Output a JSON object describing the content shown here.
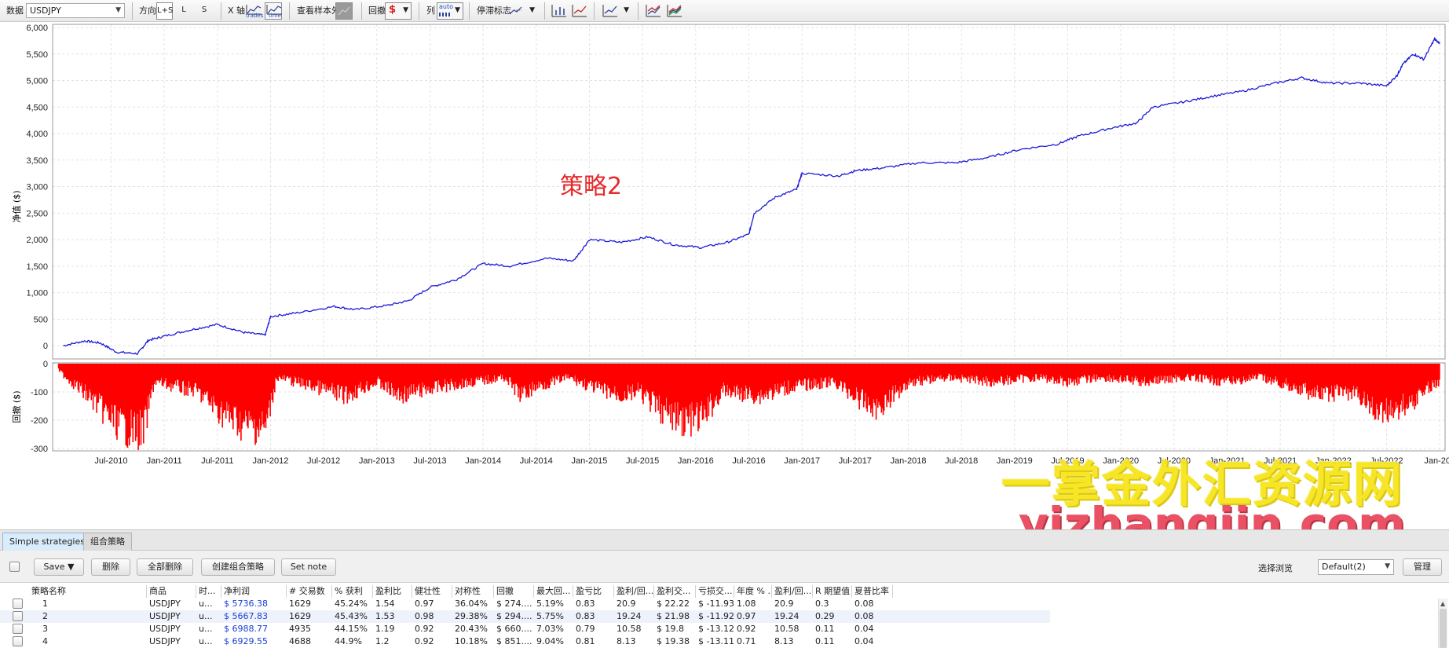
{
  "toolbar": {
    "data_label": "数据",
    "symbol_value": "USDJPY",
    "direction_label": "方向",
    "dir_both": "L+S",
    "dir_long": "L",
    "dir_short": "S",
    "xaxis_label": "X 轴",
    "xaxis_trades": "trades",
    "xaxis_time": "time",
    "oos_label": "查看样本外",
    "drawdown_label": "回撤",
    "drawdown_unit": "$",
    "columns_label": "列",
    "columns_auto": "auto",
    "stop_label": "停滞标志"
  },
  "chart": {
    "annotation": "策略2",
    "equity_ylabel": "净值 ($)",
    "drawdown_ylabel": "回撤 ($)",
    "line_color": "#1a1ad8",
    "bar_color": "#ff0000"
  },
  "watermark": {
    "line1": "一掌金外汇资源网",
    "line2": "yizhangjin.com"
  },
  "chart_data": [
    {
      "type": "line",
      "title": "",
      "xlabel": "",
      "ylabel": "净值 ($)",
      "ylim": [
        -200,
        6000
      ],
      "yticks": [
        "6,000",
        "5,500",
        "5,000",
        "4,500",
        "4,000",
        "3,500",
        "3,000",
        "2,500",
        "2,000",
        "1,500",
        "1,000",
        "500",
        "0"
      ],
      "x_ticks": [
        "Jul-2010",
        "Jan-2011",
        "Jul-2011",
        "Jan-2012",
        "Jul-2012",
        "Jan-2013",
        "Jul-2013",
        "Jan-2014",
        "Jul-2014",
        "Jan-2015",
        "Jul-2015",
        "Jan-2016",
        "Jul-2016",
        "Jan-2017",
        "Jul-2017",
        "Jan-2018",
        "Jul-2018",
        "Jan-2019",
        "Jul-2019",
        "Jan-2020",
        "Jul-2020",
        "Jan-2021",
        "Jul-2021",
        "Jan-2022",
        "Jul-2022",
        "Jan-202"
      ],
      "grid": true,
      "series": [
        {
          "x": [
            2010.05,
            2010.25,
            2010.4,
            2010.55,
            2010.75,
            2010.85,
            2011.0,
            2011.25,
            2011.5,
            2011.75,
            2011.95,
            2012.0,
            2012.25,
            2012.6,
            2012.8,
            2013.1,
            2013.3,
            2013.5,
            2013.75,
            2014.0,
            2014.25,
            2014.6,
            2014.85,
            2015.0,
            2015.3,
            2015.55,
            2015.8,
            2016.05,
            2016.3,
            2016.5,
            2016.55,
            2016.75,
            2016.95,
            2017.0,
            2017.35,
            2017.5,
            2017.75,
            2018.1,
            2018.45,
            2018.75,
            2019.05,
            2019.4,
            2019.6,
            2019.9,
            2020.15,
            2020.3,
            2020.6,
            2020.85,
            2021.15,
            2021.45,
            2021.7,
            2021.95,
            2022.25,
            2022.5,
            2022.6,
            2022.65,
            2022.75,
            2022.85,
            2022.95,
            2023.0
          ],
          "y": [
            0,
            90,
            50,
            -120,
            -150,
            100,
            180,
            300,
            400,
            250,
            200,
            550,
            620,
            740,
            680,
            760,
            850,
            1100,
            1250,
            1550,
            1500,
            1650,
            1600,
            2000,
            1950,
            2050,
            1900,
            1850,
            1950,
            2100,
            2500,
            2800,
            2950,
            3250,
            3200,
            3300,
            3350,
            3450,
            3450,
            3550,
            3700,
            3800,
            3950,
            4100,
            4200,
            4500,
            4600,
            4700,
            4800,
            4950,
            5050,
            4950,
            4950,
            4900,
            5100,
            5300,
            5500,
            5400,
            5780,
            5700
          ]
        }
      ]
    },
    {
      "type": "bar",
      "title": "",
      "xlabel": "",
      "ylabel": "回撤 ($)",
      "ylim": [
        -300,
        0
      ],
      "yticks": [
        "0",
        "-100",
        "-200",
        "-300"
      ],
      "grid": true,
      "series": [
        {
          "x": [
            2010.0,
            2010.3,
            2010.45,
            2010.6,
            2010.8,
            2010.9,
            2011.3,
            2011.55,
            2011.75,
            2011.95,
            2012.05,
            2012.4,
            2012.7,
            2013.0,
            2013.2,
            2013.6,
            2013.9,
            2014.2,
            2014.35,
            2014.5,
            2014.8,
            2015.0,
            2015.3,
            2015.45,
            2015.6,
            2015.75,
            2015.9,
            2016.05,
            2016.25,
            2016.6,
            2016.9,
            2017.3,
            2017.55,
            2017.7,
            2018.0,
            2018.4,
            2018.8,
            2019.2,
            2019.5,
            2019.8,
            2020.2,
            2020.6,
            2021.0,
            2021.3,
            2021.6,
            2021.9,
            2022.1,
            2022.3,
            2022.4,
            2022.55,
            2022.7,
            2022.9,
            2023.0
          ],
          "values": [
            -30,
            -150,
            -220,
            -280,
            -300,
            -80,
            -120,
            -220,
            -270,
            -280,
            -60,
            -100,
            -140,
            -80,
            -140,
            -100,
            -80,
            -60,
            -140,
            -100,
            -60,
            -100,
            -140,
            -120,
            -180,
            -230,
            -250,
            -240,
            -120,
            -140,
            -100,
            -80,
            -160,
            -200,
            -80,
            -60,
            -80,
            -60,
            -80,
            -60,
            -80,
            -60,
            -80,
            -60,
            -100,
            -140,
            -120,
            -160,
            -220,
            -200,
            -180,
            -100,
            -80
          ]
        }
      ]
    }
  ],
  "panel": {
    "tabs": [
      "Simple strategies",
      "组合策略"
    ],
    "buttons": {
      "save": "Save ▼",
      "delete": "删除",
      "delete_all": "全部删除",
      "create_portfolio": "创建组合策略",
      "set_note": "Set note",
      "manage": "管理"
    },
    "browse_label": "选择浏览",
    "browse_value": "Default(2)"
  },
  "table": {
    "headers": [
      "策略名称",
      "商品",
      "时...",
      "净利润",
      "# 交易数",
      "% 获利",
      "盈利比",
      "健壮性",
      "对称性",
      "回撤",
      "最大回...",
      "盈亏比",
      "盈利/回...",
      "盈利交...",
      "亏损交...",
      "年度 % ...",
      "盈利/回...",
      "R 期望值",
      "夏普比率"
    ],
    "rows": [
      [
        "1",
        "USDJPY",
        "u...",
        "$ 5736.38",
        "1629",
        "45.24%",
        "1.54",
        "0.97",
        "36.04%",
        "$ 274....",
        "5.19%",
        "0.83",
        "20.9",
        "$ 22.22",
        "$ -11.93",
        "1.08",
        "20.9",
        "0.3",
        "0.08"
      ],
      [
        "2",
        "USDJPY",
        "u...",
        "$ 5667.83",
        "1629",
        "45.43%",
        "1.53",
        "0.98",
        "29.38%",
        "$ 294....",
        "5.75%",
        "0.83",
        "19.24",
        "$ 21.98",
        "$ -11.92",
        "0.97",
        "19.24",
        "0.29",
        "0.08"
      ],
      [
        "3",
        "USDJPY",
        "u...",
        "$ 6988.77",
        "4935",
        "44.15%",
        "1.19",
        "0.92",
        "20.43%",
        "$ 660....",
        "7.03%",
        "0.79",
        "10.58",
        "$ 19.8",
        "$ -13.12",
        "0.92",
        "10.58",
        "0.11",
        "0.04"
      ],
      [
        "4",
        "USDJPY",
        "u...",
        "$ 6929.55",
        "4688",
        "44.9%",
        "1.2",
        "0.92",
        "10.18%",
        "$ 851....",
        "9.04%",
        "0.81",
        "8.13",
        "$ 19.38",
        "$ -13.11",
        "0.71",
        "8.13",
        "0.11",
        "0.04"
      ]
    ]
  }
}
